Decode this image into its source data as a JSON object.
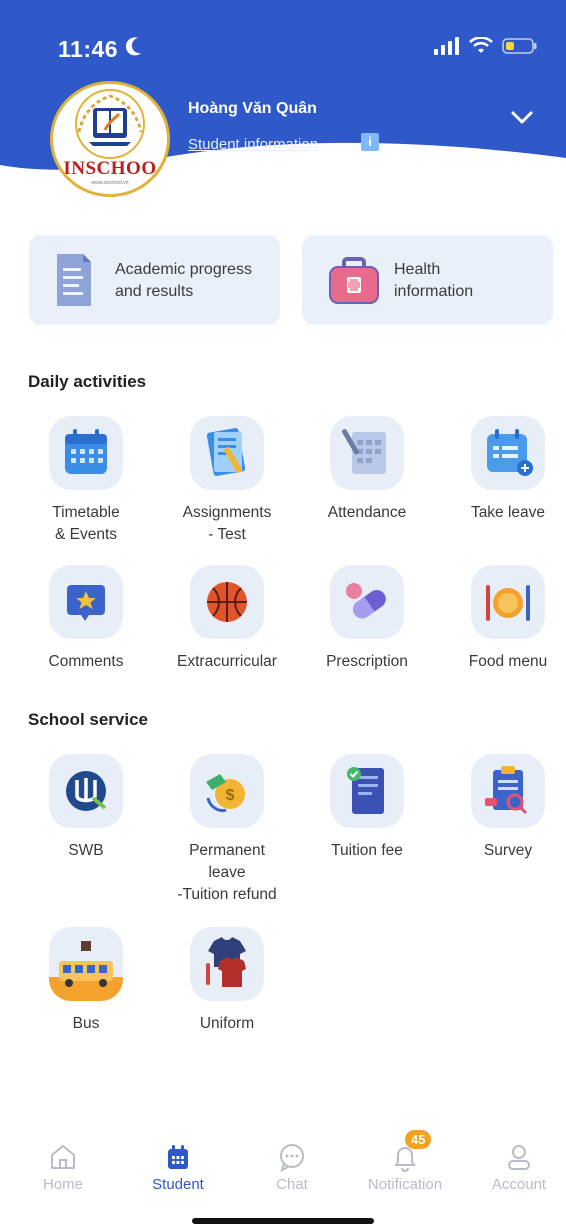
{
  "status_bar": {
    "time": "11:46"
  },
  "profile": {
    "name": "Hoàng Văn Quân",
    "subtitle": "Student information",
    "logo_text": "INSCHOO",
    "logo_subtext": "www.inschool.vn"
  },
  "cards": [
    {
      "label_line1": "Academic progress",
      "label_line2": "and results",
      "icon": "document-icon"
    },
    {
      "label_line1": "Health",
      "label_line2": "information",
      "icon": "first-aid-kit-icon"
    }
  ],
  "daily_activities": {
    "title": "Daily activities",
    "items": [
      {
        "line1": "Timetable",
        "line2": "& Events",
        "icon": "calendar-icon"
      },
      {
        "line1": "Assignments",
        "line2": "- Test",
        "icon": "assignment-icon"
      },
      {
        "line1": "Attendance",
        "line2": "",
        "icon": "attendance-icon"
      },
      {
        "line1": "Take leave",
        "line2": "",
        "icon": "take-leave-icon"
      },
      {
        "line1": "Comments",
        "line2": "",
        "icon": "comment-star-icon"
      },
      {
        "line1": "Extracurricular",
        "line2": "",
        "icon": "basketball-icon"
      },
      {
        "line1": "Prescription",
        "line2": "",
        "icon": "pill-icon"
      },
      {
        "line1": "Food menu",
        "line2": "",
        "icon": "food-plate-icon"
      }
    ]
  },
  "school_service": {
    "title": "School service",
    "items": [
      {
        "line1": "SWB",
        "line2": "",
        "line3": "",
        "icon": "swb-logo-icon"
      },
      {
        "line1": "Permanent",
        "line2": "leave",
        "line3": "-Tuition refund",
        "icon": "money-refund-icon"
      },
      {
        "line1": "Tuition fee",
        "line2": "",
        "line3": "",
        "icon": "invoice-icon"
      },
      {
        "line1": "Survey",
        "line2": "",
        "line3": "",
        "icon": "survey-icon"
      },
      {
        "line1": "Bus",
        "line2": "",
        "line3": "",
        "icon": "bus-icon"
      },
      {
        "line1": "Uniform",
        "line2": "",
        "line3": "",
        "icon": "uniform-icon"
      }
    ]
  },
  "tabbar": {
    "tabs": [
      {
        "label": "Home",
        "icon": "home-icon"
      },
      {
        "label": "Student",
        "icon": "student-calendar-icon"
      },
      {
        "label": "Chat",
        "icon": "chat-icon"
      },
      {
        "label": "Notification",
        "icon": "bell-icon",
        "badge": "45"
      },
      {
        "label": "Account",
        "icon": "account-icon"
      }
    ],
    "active": "Student"
  },
  "colors": {
    "header": "#2f58c9",
    "accent": "#2f58c9",
    "badge": "#f4a21d",
    "card_bg": "#eaf0f9"
  }
}
